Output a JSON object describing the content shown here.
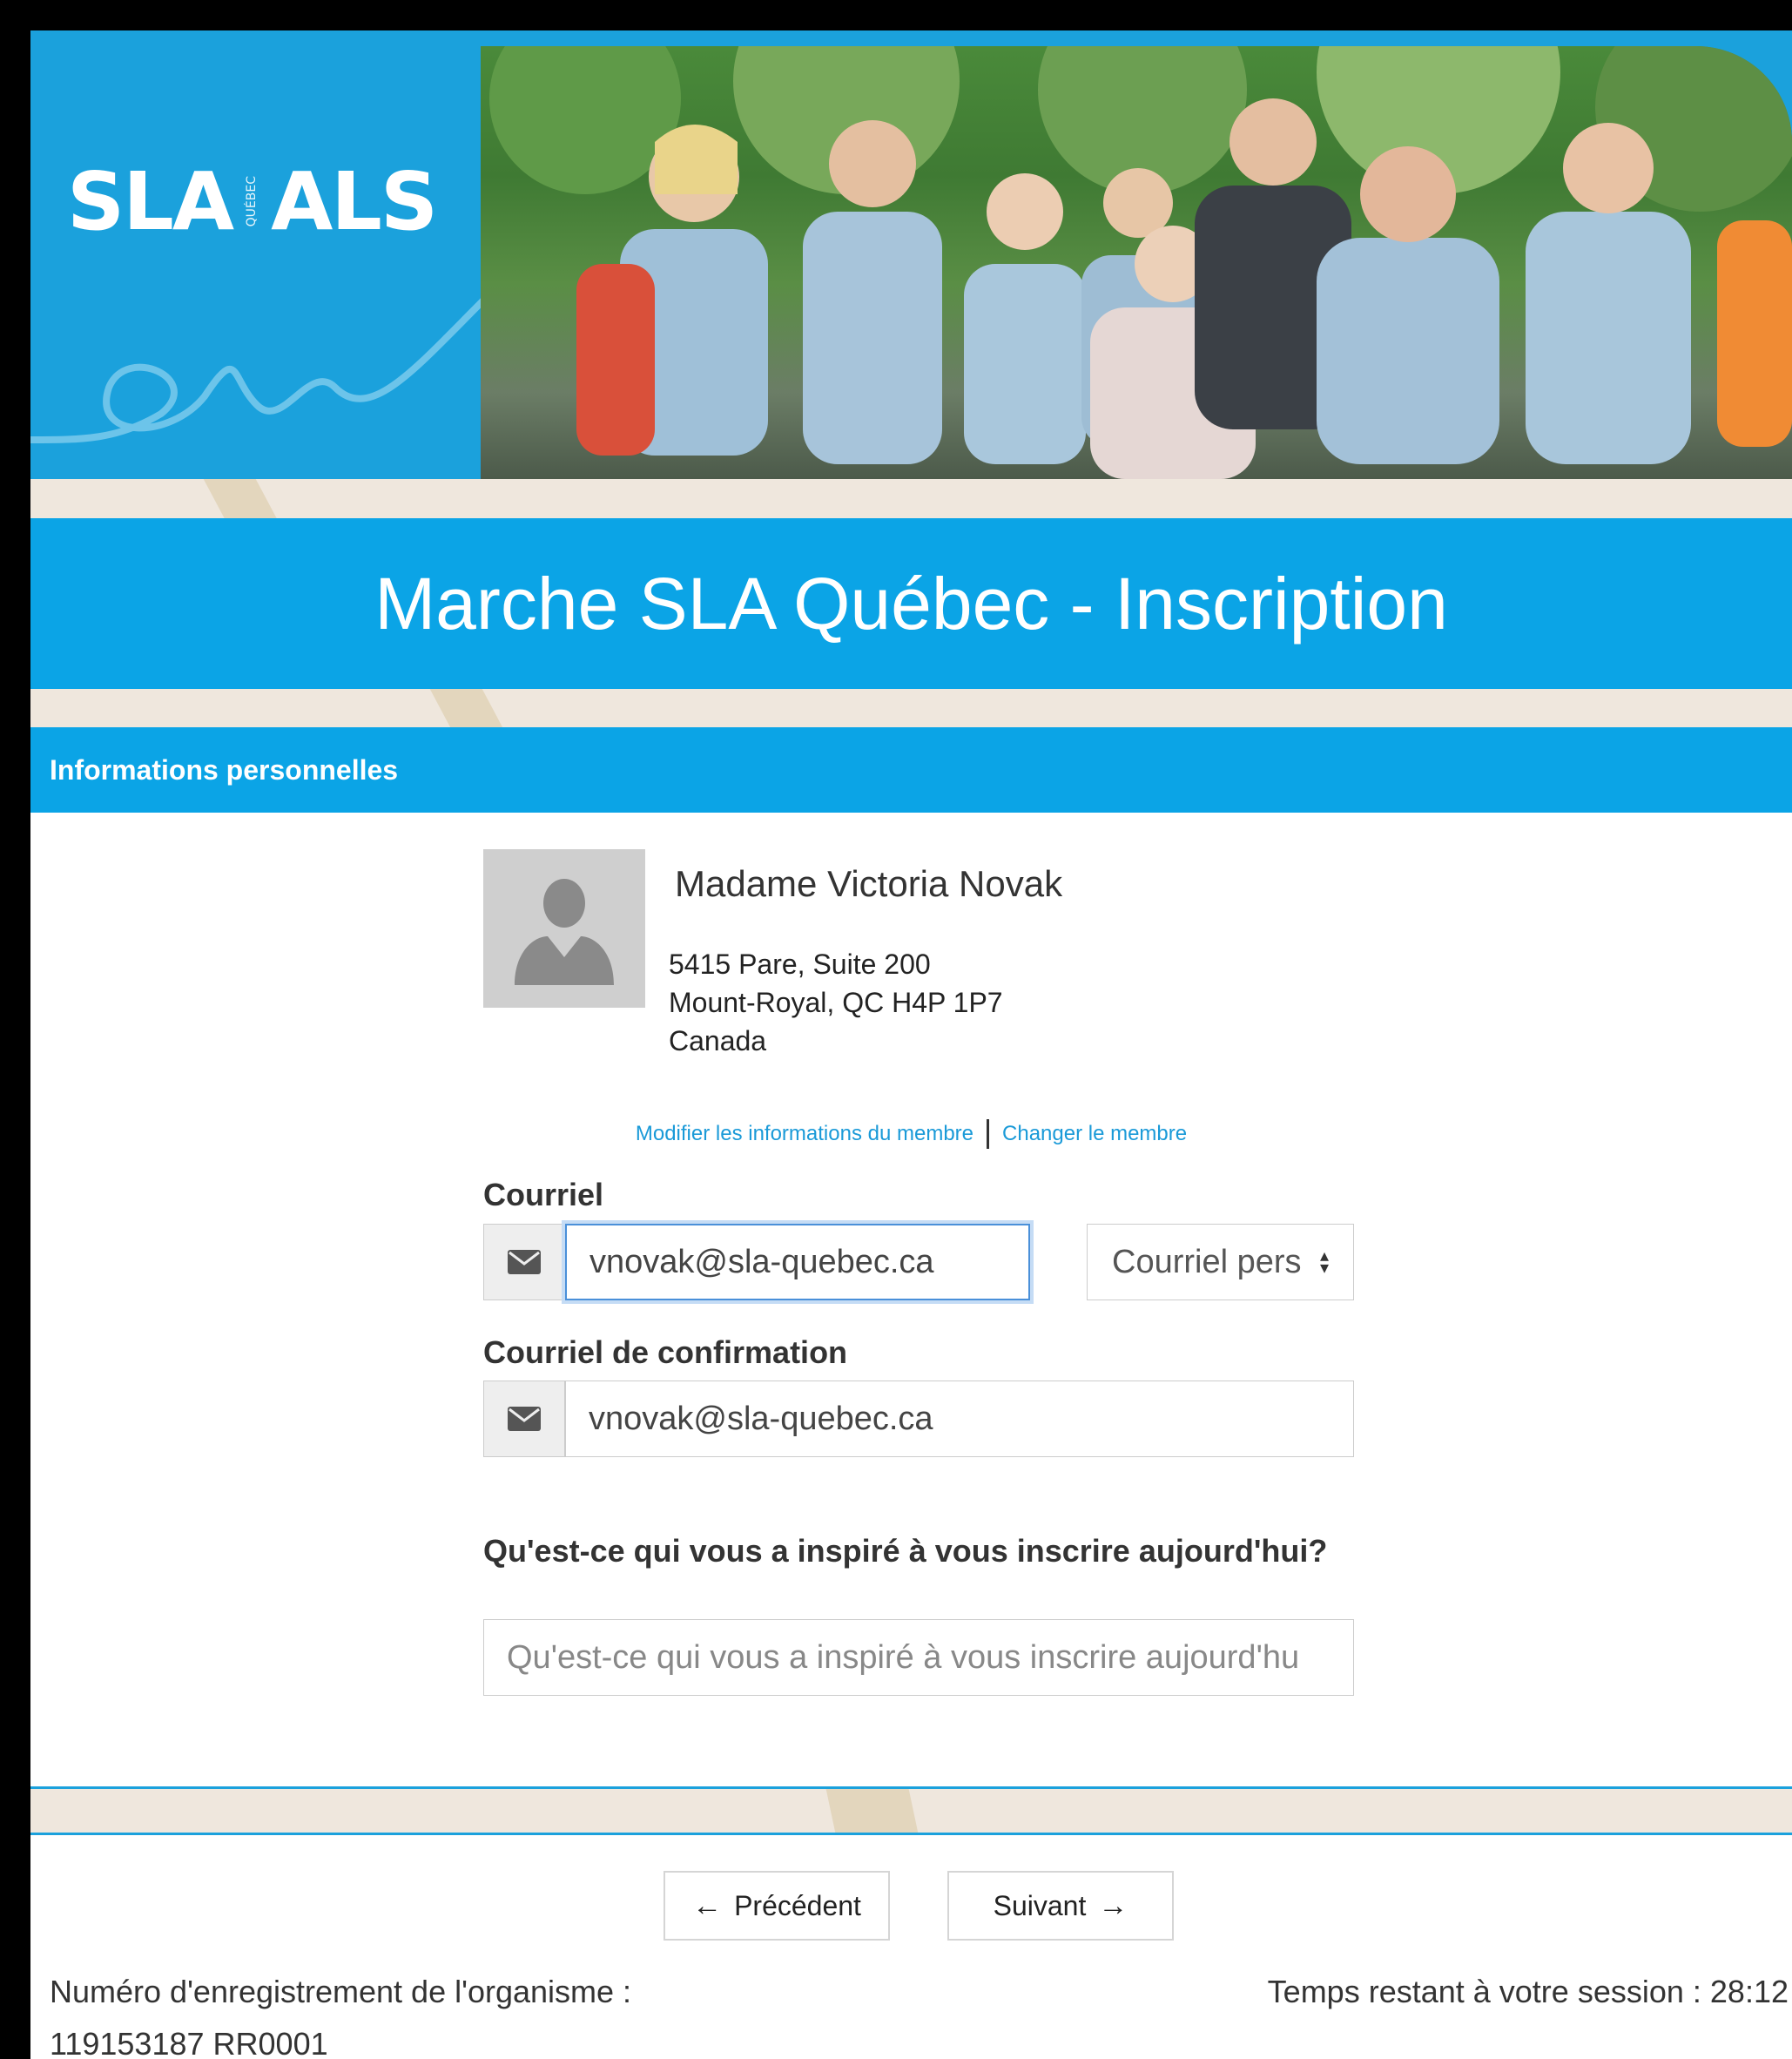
{
  "header": {
    "logo_text_left": "SLA",
    "logo_text_separator": "QUÉBEC",
    "logo_text_right": "ALS",
    "title": "Marche SLA Québec - Inscription"
  },
  "section": {
    "title": "Informations personnelles"
  },
  "member": {
    "name": "Madame Victoria Novak",
    "address_line1": "5415 Pare, Suite 200",
    "address_line2": "Mount-Royal, QC H4P 1P7",
    "address_line3": "Canada",
    "edit_link": "Modifier les informations du membre",
    "change_link": "Changer le membre"
  },
  "form": {
    "email_label": "Courriel",
    "email_value": "vnovak@sla-quebec.ca",
    "email_type_selected": "Courriel pers",
    "confirm_label": "Courriel de confirmation",
    "confirm_value": "vnovak@sla-quebec.ca",
    "inspiration_label": "Qu'est-ce qui vous a inspiré à vous inscrire aujourd'hui?",
    "inspiration_placeholder": "Qu'est-ce qui vous a inspiré à vous inscrire aujourd'hu"
  },
  "nav": {
    "previous_label": "Précédent",
    "next_label": "Suivant"
  },
  "footer": {
    "registration_label": "Numéro d'enregistrement de l'organisme :",
    "registration_number": "119153187 RR0001",
    "session_label": "Temps restant à votre session :",
    "session_time": "28:12"
  },
  "colors": {
    "brand_blue": "#0ba4e6",
    "banner_blue": "#1ba1dc",
    "beige": "#efe7dd",
    "link_blue": "#1a9ad8"
  },
  "icons": {
    "email": "envelope-icon",
    "avatar": "person-silhouette-icon",
    "previous": "arrow-left-icon",
    "next": "arrow-right-icon",
    "select": "sort-caret-icon"
  }
}
